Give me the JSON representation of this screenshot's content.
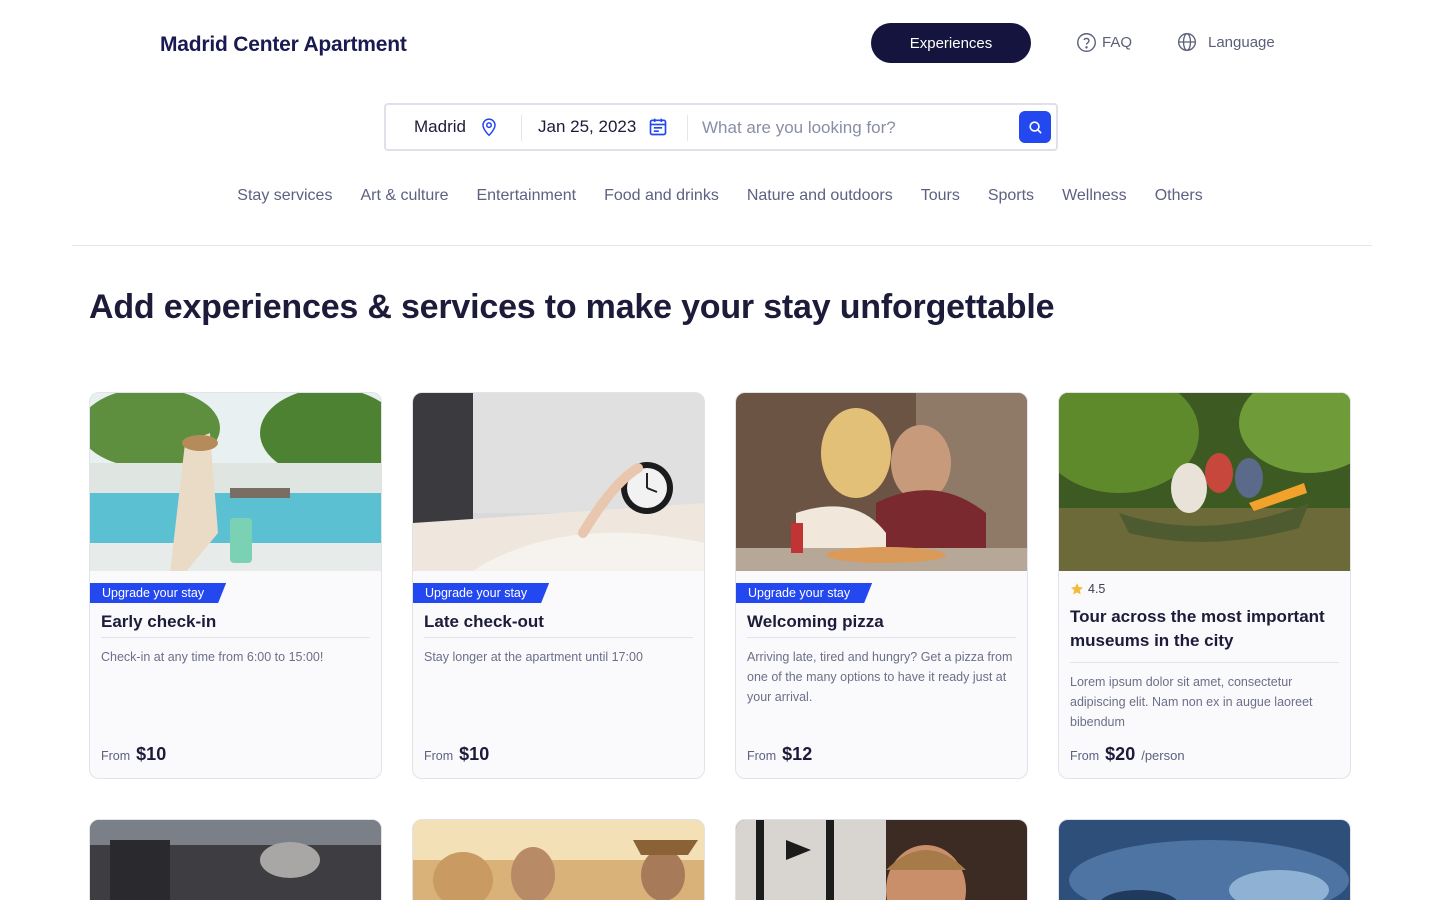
{
  "header": {
    "brand": "Madrid Center Apartment",
    "experiences_label": "Experiences",
    "faq_label": "FAQ",
    "language_label": "Language"
  },
  "search": {
    "location": "Madrid",
    "date": "Jan 25, 2023",
    "placeholder": "What are you looking for?"
  },
  "categories": [
    "Stay services",
    "Art & culture",
    "Entertainment",
    "Food and drinks",
    "Nature and outdoors",
    "Tours",
    "Sports",
    "Wellness",
    "Others"
  ],
  "heading": "Add experiences & services to make your stay unforgettable",
  "colors": {
    "primary": "#2448f0",
    "dark": "#14143e",
    "text": "#1c1c3a",
    "muted": "#5d6182"
  },
  "cards": [
    {
      "tag": "Upgrade your stay",
      "title": "Early check-in",
      "description": "Check-in at any time from 6:00 to 15:00!",
      "from_label": "From",
      "price": "$10"
    },
    {
      "tag": "Upgrade your stay",
      "title": "Late check-out",
      "description": "Stay longer at the apartment until 17:00",
      "from_label": "From",
      "price": "$10"
    },
    {
      "tag": "Upgrade your stay",
      "title": "Welcoming pizza",
      "description": "Arriving late, tired and hungry? Get a pizza from one of the many options to have it ready just at your arrival.",
      "from_label": "From",
      "price": "$12"
    },
    {
      "rating": "4.5",
      "title": "Tour across the most important museums in the city",
      "description": "Lorem ipsum dolor sit amet, consectetur adipiscing elit. Nam non ex in augue laoreet bibendum",
      "from_label": "From",
      "price": "$20",
      "unit": "/person"
    }
  ]
}
